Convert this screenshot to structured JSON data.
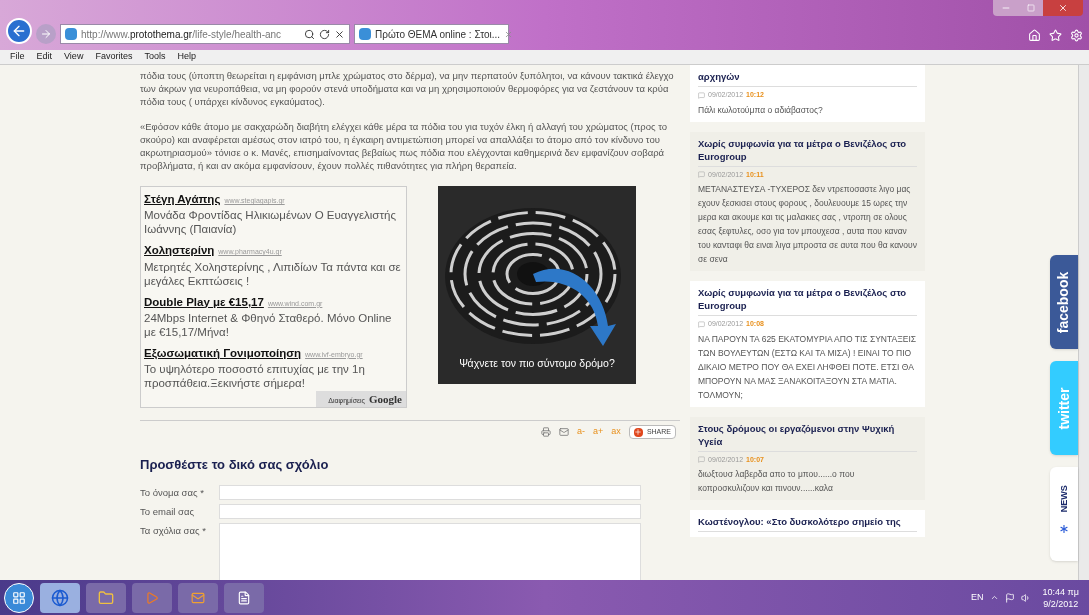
{
  "browser": {
    "address": "http://www.**protothema.gr**/life-style/health-anc",
    "tab": {
      "title": "Πρώτο ΘΕΜΑ online : Στοι...",
      "selected": true
    }
  },
  "menu": [
    "File",
    "Edit",
    "View",
    "Favorites",
    "Tools",
    "Help"
  ],
  "article": {
    "paragraphs": [
      "πόδια τους (ύποπτη θεωρείται η εμφάνιση μπλε χρώματος στο δέρμα), να μην περπατούν ξυπόλητοι, να κάνουν τακτικά έλεγχο των άκρων για νευροπάθεια, να μη φορούν στενά υποδήματα και να μη χρησιμοποιούν θερμοφόρες για να ζεστάνουν τα κρύα πόδια τους ( υπάρχει κίνδυνος εγκαύματος).",
      "«Εφόσον κάθε άτομο με σακχαρώδη διαβήτη ελέγχει κάθε μέρα τα πόδια του για τυχόν έλκη ή αλλαγή του χρώματος (προς το σκούρο) και αναφέρεται αμέσως στον ιατρό του, η έγκαιρη αντιμετώπιση μπορεί να απαλλάξει το άτομο από τον κίνδυνο του ακρωτηριασμού» τόνισε ο κ. Μανές, επισημαίνοντας βεβαίως πως  πόδια που ελέγχονται καθημερινά δεν εμφανίζουν σοβαρά προβλήματα, ή και αν ακόμα εμφανίσουν, έχουν πολλές πιθανότητες για πλήρη θεραπεία."
    ]
  },
  "ads": {
    "items": [
      {
        "title": "Στέγη Αγάπης",
        "url": "www.stegiagapis.gr",
        "text": "Μονάδα Φροντίδας Ηλικιωμένων Ο Ευαγγελιστής Ιωάννης (Παιανία)"
      },
      {
        "title": "Χοληστερίνη",
        "url": "www.pharmacy4u.gr",
        "text": "Μετρητές Χοληστερίνης , Λιπιδίων Τα πάντα και σε μεγάλες Εκπτώσεις !"
      },
      {
        "title": "Double Play με €15,17",
        "url": "www.wind.com.gr",
        "text": "24Mbps Internet & Φθηνό Σταθερό. Μόνο Online με €15,17/Μήνα!"
      },
      {
        "title": "Εξωσωματική Γονιμοποίηση",
        "url": "www.ivf-embryo.gr",
        "text": "Το υψηλότερο ποσοστό επιτυχίας με την 1η προσπάθεια.Ξεκινήστε σήμερα!"
      }
    ],
    "label": "Διαφημίσεις",
    "brand": "Google"
  },
  "banner": {
    "caption": "Ψάχνετε τον πιο σύντομο δρόμο?"
  },
  "toolbar": {
    "font_buttons": [
      "a-",
      "a+",
      "ax"
    ],
    "share": "SHARE"
  },
  "comment_form": {
    "title": "Προσθέστε το δικό σας σχόλιο",
    "fields": [
      {
        "label": "Το όνομα σας *",
        "kind": "input"
      },
      {
        "label": "Το email σας",
        "kind": "input"
      },
      {
        "label": "Τα σχόλια σας *",
        "kind": "textarea"
      }
    ]
  },
  "comments": [
    {
      "title": "αρχηγών",
      "date": "09/02/2012",
      "time": "10:12",
      "text": "Πάλι κωλοτούμπα ο αδιάβαστος?"
    },
    {
      "title": "Χωρίς συμφωνία για τα μέτρα ο Βενιζέλος στο Eurogroup",
      "date": "09/02/2012",
      "time": "10:11",
      "text": "ΜΕΤΑΝΑΣΤΕΥΣΑ -ΤΥΧΕΡΟΣ δεν ντρεποσαστε λιγο μας εχουν ξεσκισει στους φορους , δουλευουμε 15 ωρες την μερα και ακουμε και τις μαλακιες σας , ντροπη σε ολους εσας ξεφτυλες, οσο για τον μπουχεσα , αυτα που καναν του κανταφι θα ειναι λιγα μπροστα σε αυτα που θα κανουν σε σενα"
    },
    {
      "title": "Χωρίς συμφωνία για τα μέτρα ο Βενιζέλος στο Eurogroup",
      "date": "09/02/2012",
      "time": "10:08",
      "text": "ΝΑ ΠΑΡΟΥΝ ΤΑ 625 ΕΚΑΤΟΜΥΡΙΑ ΑΠΟ ΤΙΣ ΣΥΝΤΑΞΕΙΣ ΤΩΝ ΒΟΥΛΕΥΤΩΝ (ΕΣΤΩ ΚΑΙ ΤΑ ΜΙΣΑ) ! ΕΙΝΑΙ ΤΟ ΠΙΟ ΔΙΚΑΙΟ ΜΕΤΡΟ ΠΟΥ ΘΑ ΕΧΕΙ ΛΗΦΘΕΙ ΠΟΤΕ. ΕΤΣΙ ΘΑ ΜΠΟΡΟΥΝ ΝΑ ΜΑΣ ΞΑΝΑΚΟΙΤΑΞΟΥΝ ΣΤΑ ΜΑΤΙΑ. ΤΟΛΜΟΥΝ;"
    },
    {
      "title": "Στους δρόμους οι εργαζόμενοι στην Ψυχική Υγεία",
      "date": "09/02/2012",
      "time": "10:07",
      "text": "διωξτουσ λαβερδα απο το μπου......ο που κοπροσκυλιζουν και πινουν......καλα"
    },
    {
      "title": "Κωστένογλου: «Στο δυσκολότερο σημείο της"
    }
  ],
  "social": [
    {
      "label": "facebook",
      "kind": "facebook"
    },
    {
      "label": "twitter",
      "kind": "twitter"
    },
    {
      "label": "NEWS",
      "kind": "news"
    }
  ],
  "taskbar": {
    "language": "EN",
    "time": "10:44 πμ",
    "date": "9/2/2012"
  }
}
